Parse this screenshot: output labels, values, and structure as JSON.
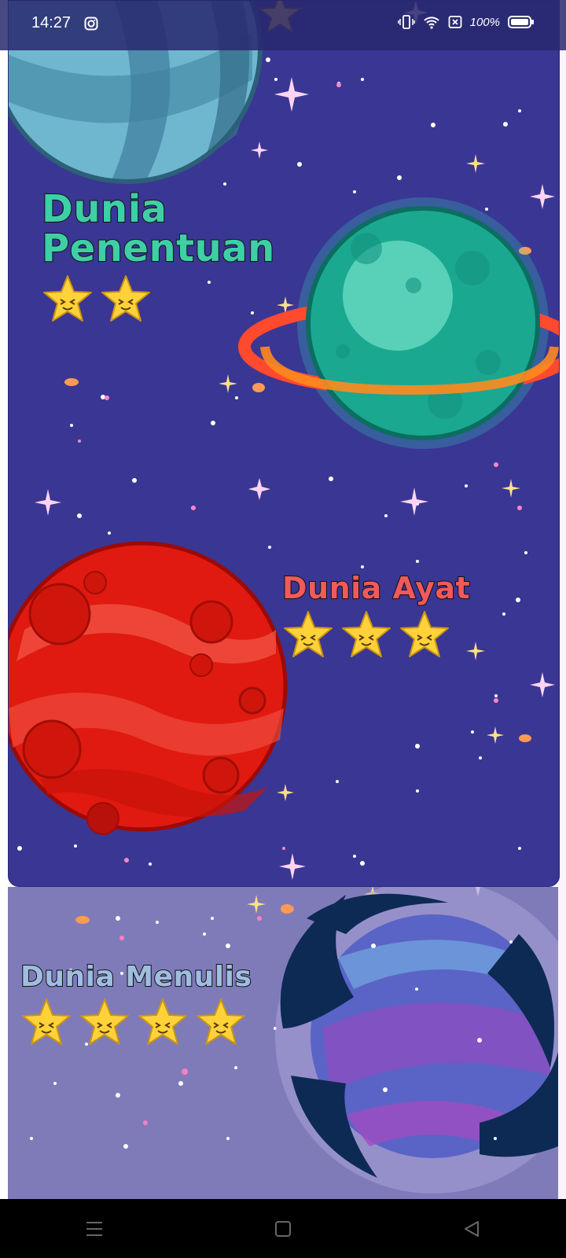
{
  "status_bar": {
    "time": "14:27",
    "battery": "100%",
    "icons": [
      "instagram-icon",
      "vibrate-icon",
      "wifi-icon",
      "no-sim-icon",
      "battery-icon"
    ]
  },
  "worlds": [
    {
      "name": "Dunia Penentuan",
      "line1": "Dunia",
      "line2": "Penentuan",
      "stars": 2,
      "color": "#3ecfa6",
      "planet": "teal-ringed-planet"
    },
    {
      "name": "Dunia Ayat",
      "stars": 3,
      "color": "#f05a5a",
      "planet": "red-planet"
    },
    {
      "name": "Dunia Menulis",
      "stars": 4,
      "color": "#9fbde0",
      "planet": "purple-swirl-planet"
    }
  ],
  "colors": {
    "space_dark": "#3a3694",
    "space_light": "#7f7bb9",
    "star_fill": "#ffd23a"
  },
  "nav_bar": {
    "buttons": [
      "menu-icon",
      "home-icon",
      "back-icon"
    ]
  }
}
